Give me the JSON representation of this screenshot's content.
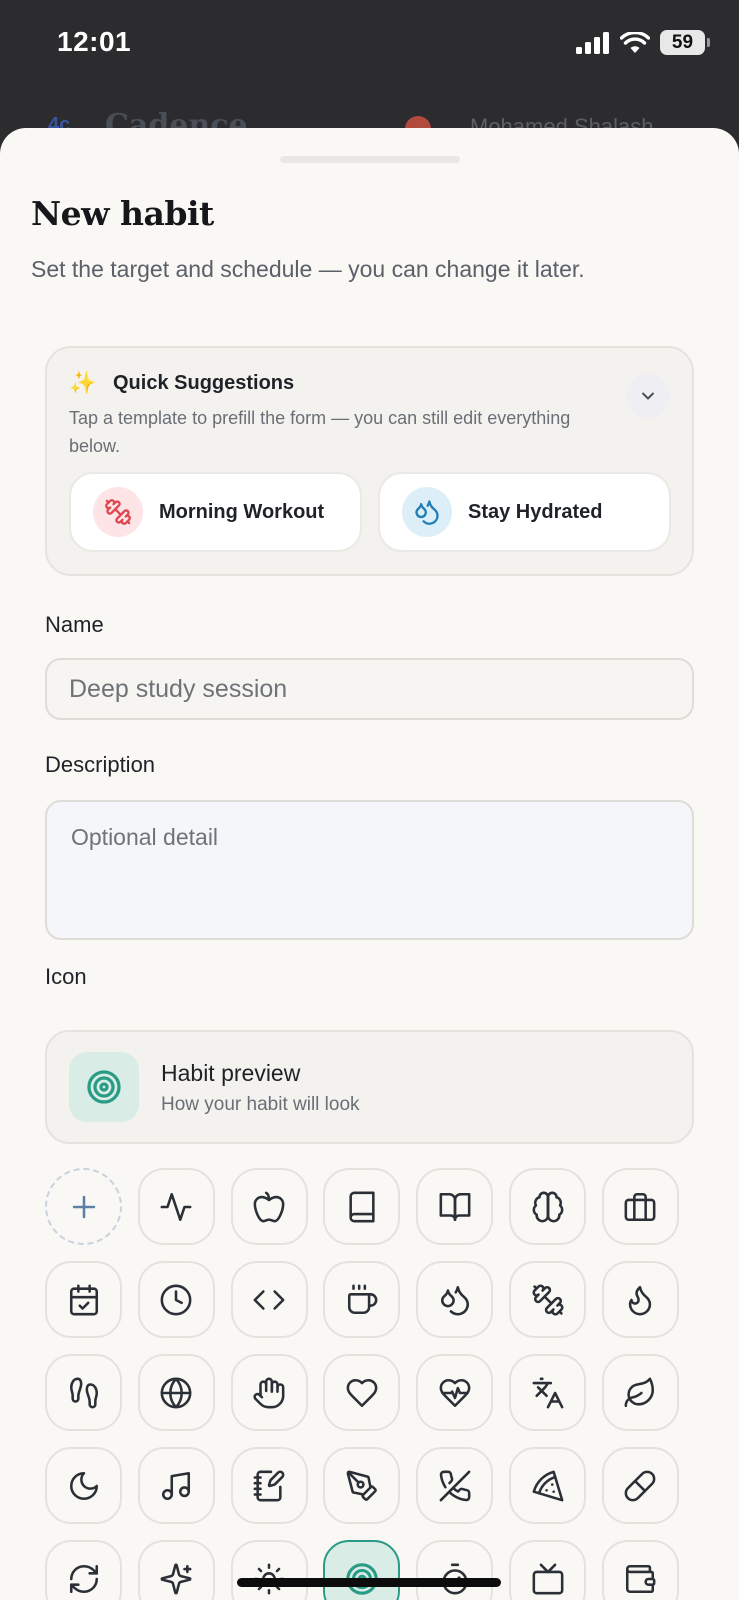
{
  "status": {
    "time": "12:01",
    "battery": "59"
  },
  "background_app": {
    "title": "Cadence",
    "logo": "4c",
    "user": "Mohamed Shalash"
  },
  "sheet": {
    "title": "New habit",
    "subtitle": "Set the target and schedule — you can change it later."
  },
  "suggestions": {
    "title": "Quick Suggestions",
    "description": "Tap a template to prefill the form — you can still edit everything below.",
    "items": [
      {
        "label": "Morning Workout",
        "icon": "dumbbell-icon"
      },
      {
        "label": "Stay Hydrated",
        "icon": "droplets-icon"
      }
    ]
  },
  "form": {
    "name_label": "Name",
    "name_placeholder": "Deep study session",
    "description_label": "Description",
    "description_placeholder": "Optional detail",
    "icon_label": "Icon"
  },
  "preview": {
    "title": "Habit preview",
    "subtitle": "How your habit will look",
    "icon": "target-icon"
  },
  "icons": [
    "add-icon",
    "activity-icon",
    "apple-icon",
    "book-icon",
    "book-open-icon",
    "brain-icon",
    "briefcase-icon",
    "calendar-check-icon",
    "clock-icon",
    "code-icon",
    "coffee-icon",
    "droplets-icon",
    "dumbbell-icon",
    "flame-icon",
    "footprints-icon",
    "globe-icon",
    "hand-icon",
    "heart-icon",
    "heart-pulse-icon",
    "languages-icon",
    "leaf-icon",
    "moon-icon",
    "music-icon",
    "notebook-pen-icon",
    "pen-tool-icon",
    "phone-off-icon",
    "pizza-icon",
    "pill-icon",
    "refresh-icon",
    "sparkles-icon",
    "sun-icon",
    "target-icon",
    "timer-icon",
    "tv-icon",
    "wallet-icon"
  ],
  "selected_icon": "target-icon",
  "colors": {
    "accent": "#2a9c86",
    "sheet_bg": "#f9f8f5",
    "workout": "#e0464f",
    "hydrated": "#1f7fb6"
  }
}
